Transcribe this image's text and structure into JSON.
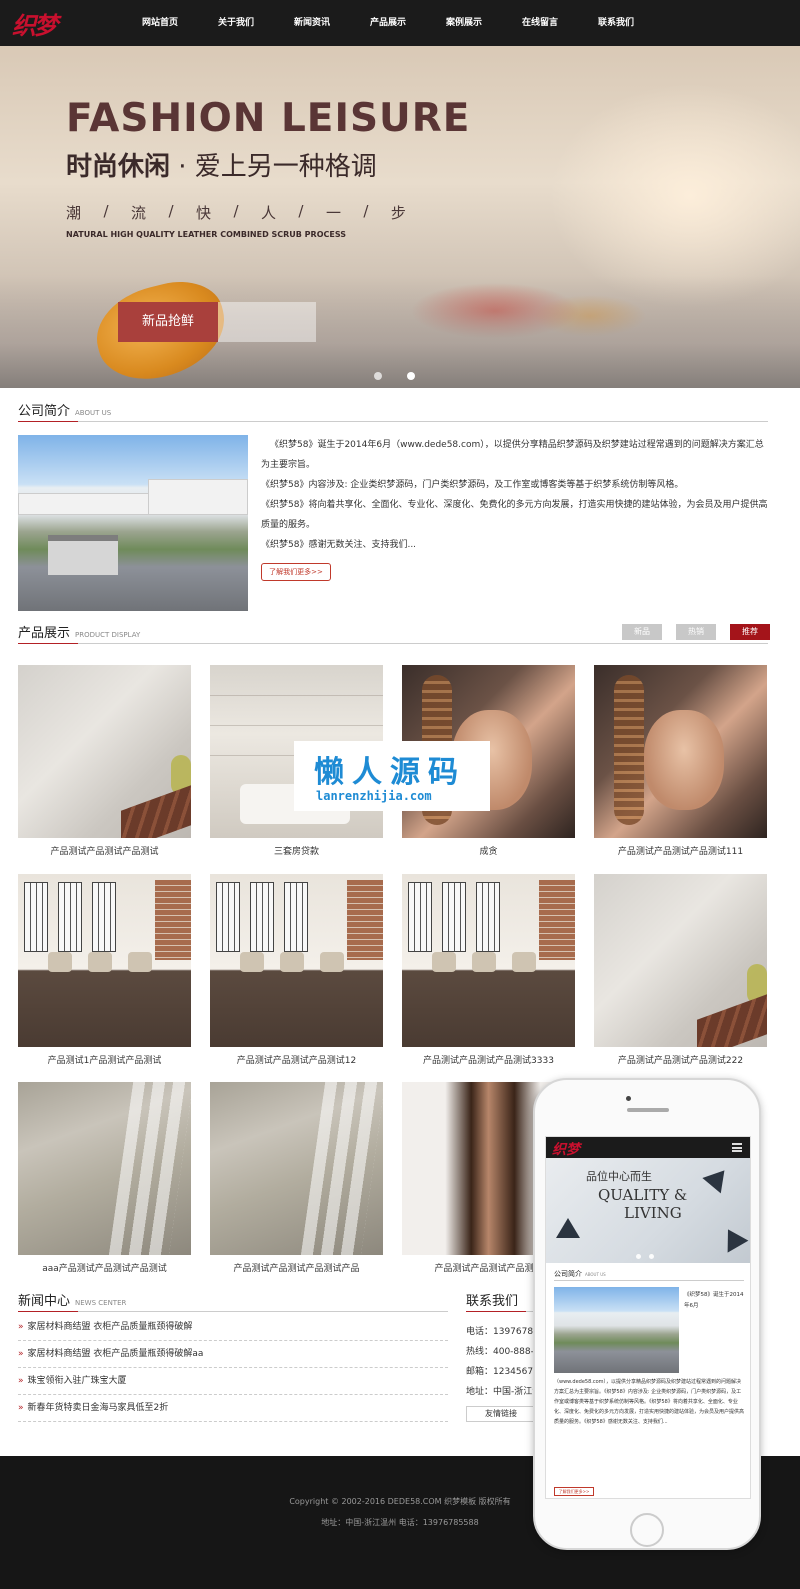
{
  "nav": {
    "logo": "织梦",
    "items": [
      "网站首页",
      "关于我们",
      "新闻资讯",
      "产品展示",
      "案例展示",
      "在线留言",
      "联系我们"
    ]
  },
  "banner": {
    "title": "FASHION LEISURE",
    "subtitle_bold": "时尚休闲",
    "subtitle_rest": " · 爱上另一种格调",
    "chars": [
      "潮",
      "/",
      "流",
      "/",
      "快",
      "/",
      "人",
      "/",
      "一",
      "/",
      "步"
    ],
    "english": "NATURAL HIGH QUALITY LEATHER COMBINED SCRUB PROCESS",
    "button": "新品抢鲜",
    "slides_total": 2,
    "slide_active": 1
  },
  "about": {
    "title_cn": "公司简介",
    "title_en": "ABOUT US",
    "paragraphs": [
      "《织梦58》诞生于2014年6月（www.dede58.com），以提供分享精品织梦源码及织梦建站过程常遇到的问题解决方案汇总为主要宗旨。",
      "《织梦58》内容涉及: 企业类织梦源码，门户类织梦源码，及工作室或博客类等基于织梦系统仿制等风格。",
      "《织梦58》将向着共享化、全面化、专业化、深度化、免费化的多元方向发展，打造实用快捷的建站体验，为会员及用户提供高质量的服务。",
      "《织梦58》感谢无数关注、支持我们..."
    ],
    "more": "了解我们更多>>"
  },
  "products": {
    "title_cn": "产品展示",
    "title_en": "PRODUCT DISPLAY",
    "tabs": [
      {
        "label": "新品",
        "active": false
      },
      {
        "label": "热销",
        "active": false
      },
      {
        "label": "推荐",
        "active": true
      }
    ],
    "items": [
      {
        "caption": "产品测试产品测试产品测试",
        "image": "tile"
      },
      {
        "caption": "三套房贷款",
        "image": "bath"
      },
      {
        "caption": "成贪",
        "image": "woman"
      },
      {
        "caption": "产品测试产品测试产品测试111",
        "image": "woman"
      },
      {
        "caption": "产品测试1产品测试产品测试",
        "image": "room"
      },
      {
        "caption": "产品测试产品测试产品测试12",
        "image": "room"
      },
      {
        "caption": "产品测试产品测试产品测试3333",
        "image": "room"
      },
      {
        "caption": "产品测试产品测试产品测试222",
        "image": "tile"
      },
      {
        "caption": "aaa产品测试产品测试产品测试",
        "image": "marble"
      },
      {
        "caption": "产品测试产品测试产品测试产品",
        "image": "marble"
      },
      {
        "caption": "产品测试产品测试产品测试",
        "image": "megan"
      }
    ]
  },
  "watermark": {
    "line1": "懒人源码",
    "line2": "lanrenzhijia.com"
  },
  "news": {
    "title_cn": "新闻中心",
    "title_en": "NEWS CENTER",
    "items": [
      "家居材料商结盟 衣柜产品质量瓶颈得破解",
      "家居材料商结盟 衣柜产品质量瓶颈得破解aa",
      "珠宝领衔入驻广珠宝大厦",
      "新春年货特卖日金海马家具低至2折"
    ]
  },
  "contact": {
    "title_cn": "联系我们",
    "rows": [
      "电话：13976785588",
      "热线：400-888-888",
      "邮箱：1234567@qq.com",
      "地址：中国-浙江温州"
    ],
    "links_button": "友情链接"
  },
  "footer": {
    "copyright": "Copyright © 2002-2016 DEDE58.COM 织梦模板 版权所有",
    "address": "地址：中国-浙江温州   电话：13976785588"
  },
  "phone": {
    "logo": "织梦",
    "banner_line1": "品位中心而生",
    "banner_line2": "QUALITY &",
    "banner_line3": "LIVING",
    "about_title": "公司简介",
    "about_en": "ABOUT US",
    "side_text": "《织梦58》诞生于2014年6月",
    "text": "（www.dede58.com），以提供分享精品织梦源码及织梦建站过程常遇到的问题解决方案汇总为主要宗旨。《织梦58》内容涉及: 企业类织梦源码，门户类织梦源码，及工作室或博客类等基于织梦系统仿制等风格。《织梦58》将向着共享化、全面化、专业化、深度化、免费化的多元方向发展，打造实用快捷的建站体验，为会员及用户提供高质量的服务。《织梦58》感谢无数关注、支持我们...",
    "more": "了解我们更多>>"
  },
  "colors": {
    "accent": "#b32025",
    "nav_bg": "#1b1b1b",
    "banner_button": "#a9403c",
    "watermark": "#1e8bd4"
  }
}
